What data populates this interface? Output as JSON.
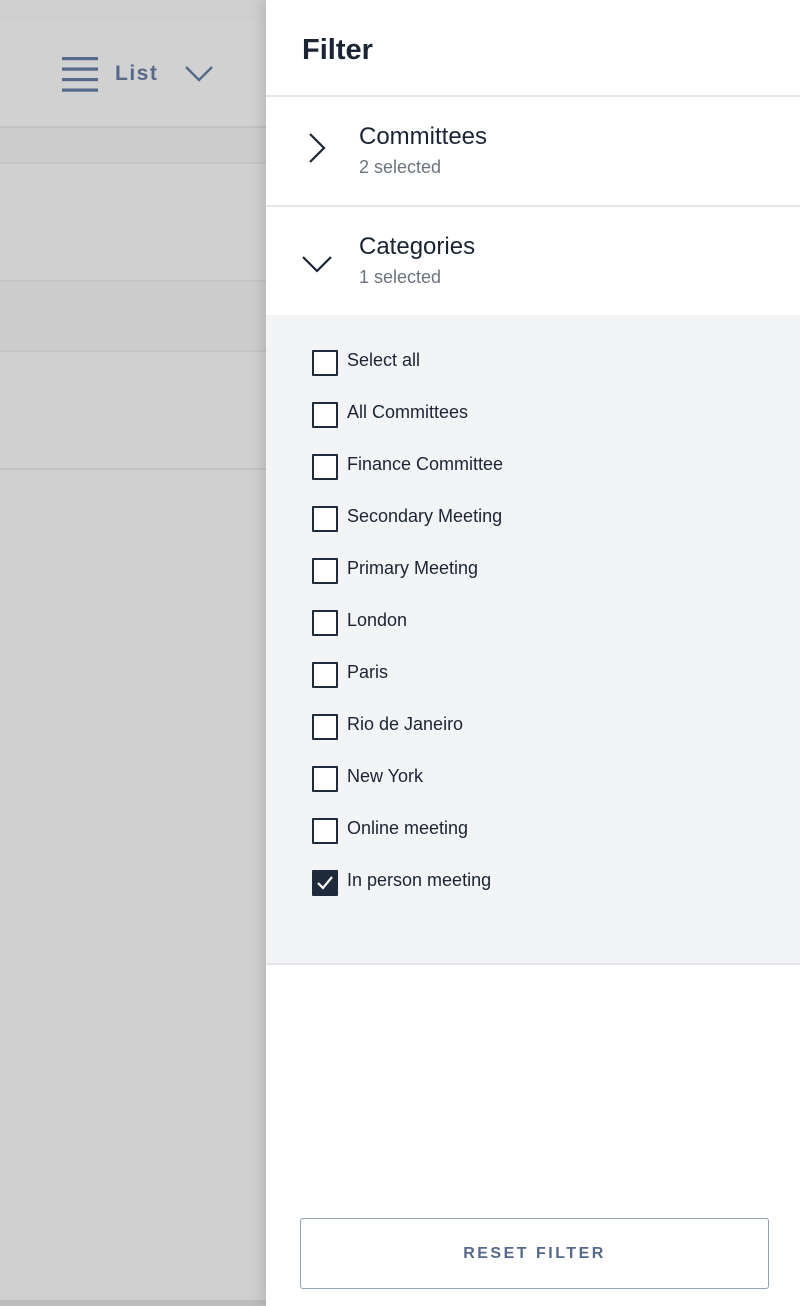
{
  "background": {
    "view_switch": {
      "label": "List",
      "icon": "list-icon",
      "chevron_icon": "chevron-down-icon"
    }
  },
  "filter_panel": {
    "title": "Filter",
    "sections": [
      {
        "title": "Committees",
        "subtitle": "2 selected",
        "expanded": false,
        "icon": "chevron-right-icon"
      },
      {
        "title": "Categories",
        "subtitle": "1 selected",
        "expanded": true,
        "icon": "chevron-down-icon"
      }
    ],
    "category_options": [
      {
        "label": "Select all",
        "checked": false
      },
      {
        "label": "All Committees",
        "checked": false
      },
      {
        "label": "Finance Committee",
        "checked": false
      },
      {
        "label": "Secondary Meeting",
        "checked": false
      },
      {
        "label": "Primary Meeting",
        "checked": false
      },
      {
        "label": "London",
        "checked": false
      },
      {
        "label": "Paris",
        "checked": false
      },
      {
        "label": "Rio de Janeiro",
        "checked": false
      },
      {
        "label": "New York",
        "checked": false
      },
      {
        "label": "Online meeting",
        "checked": false
      },
      {
        "label": "In person meeting",
        "checked": true
      }
    ],
    "reset_button_label": "RESET FILTER"
  },
  "colors": {
    "accent": "#56698a",
    "checkbox_checked": "#1f2a3a",
    "options_background": "#f3f4f6",
    "overlay_background": "#cccccc"
  }
}
